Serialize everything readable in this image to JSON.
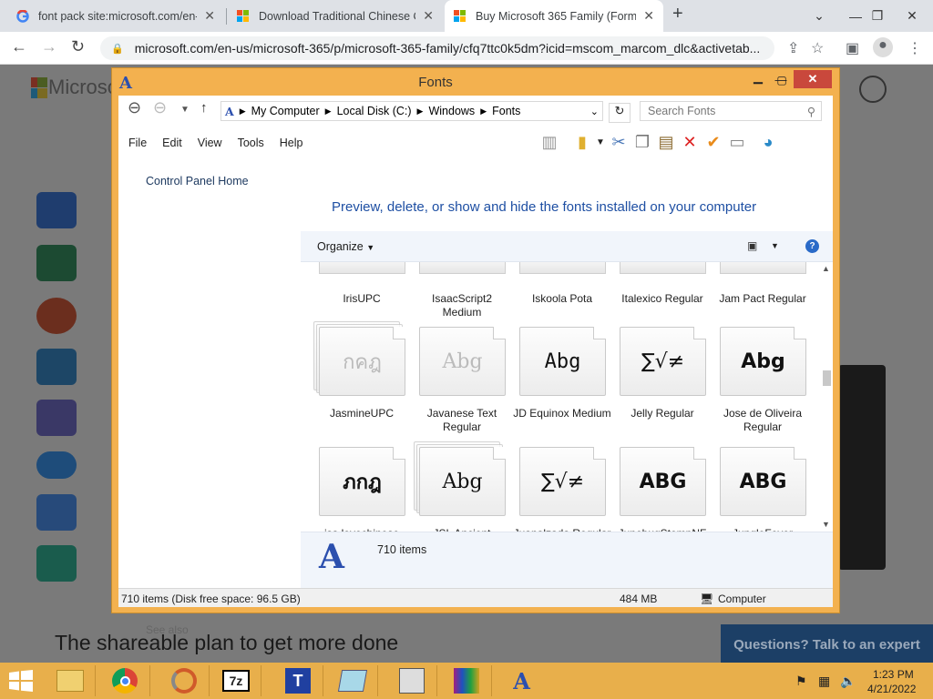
{
  "browser": {
    "tabs": [
      {
        "title": "font pack site:microsoft.com/en-",
        "active": false,
        "icon": "google-icon"
      },
      {
        "title": "Download Traditional Chinese Cl",
        "active": false,
        "icon": "microsoft-icon"
      },
      {
        "title": "Buy Microsoft 365 Family (Forme",
        "active": true,
        "icon": "microsoft-icon"
      }
    ],
    "url": "microsoft.com/en-us/microsoft-365/p/microsoft-365-family/cfq7ttc0k5dm?icid=mscom_marcom_dlc&activetab..."
  },
  "page": {
    "logo_text": "Microsoft",
    "heading": "The shareable plan to get more done",
    "chat_button": "Questions? Talk to an expert"
  },
  "dialog": {
    "title": "Fonts",
    "breadcrumbs": [
      "My Computer",
      "Local Disk (C:)",
      "Windows",
      "Fonts"
    ],
    "search_placeholder": "Search Fonts",
    "menu": [
      "File",
      "Edit",
      "View",
      "Tools",
      "Help"
    ],
    "left_link": "Control Panel Home",
    "see_also": "See also",
    "headline": "Preview, delete, or show and hide the fonts installed on your computer",
    "organize": "Organize",
    "fonts_row0": [
      "IrisUPC",
      "IsaacScript2 Medium",
      "Iskoola Pota",
      "Italexico Regular",
      "Jam Pact Regular"
    ],
    "fonts_row1": [
      {
        "name": "JasmineUPC",
        "preview": "กคฎ",
        "family": "DejaVu Sans",
        "weight": "normal",
        "stacked": true,
        "faded": true
      },
      {
        "name": "Javanese Text Regular",
        "preview": "Abg",
        "family": "DejaVu Serif",
        "weight": "normal",
        "stacked": false,
        "faded": true
      },
      {
        "name": "JD Equinox Medium",
        "preview": "Abg",
        "family": "DejaVu Sans Mono",
        "weight": "normal",
        "stacked": false,
        "faded": false
      },
      {
        "name": "Jelly Regular",
        "preview": "∑√≠",
        "family": "DejaVu Sans",
        "weight": "normal",
        "stacked": false,
        "faded": false
      },
      {
        "name": "Jose de Oliveira Regular",
        "preview": "Abg",
        "family": "DejaVu Sans",
        "weight": "bold",
        "stacked": false,
        "faded": false
      }
    ],
    "fonts_row2": [
      {
        "name": "jsa lovechinese Regular",
        "preview": "ภกฎ",
        "family": "DejaVu Serif",
        "weight": "bold",
        "stacked": false,
        "faded": false
      },
      {
        "name": "JSL Ancient",
        "preview": "Abg",
        "family": "DejaVu Serif",
        "weight": "normal",
        "stacked": true,
        "faded": false
      },
      {
        "name": "Juanalzada Regular",
        "preview": "∑√≠",
        "family": "DejaVu Sans",
        "weight": "normal",
        "stacked": false,
        "faded": false
      },
      {
        "name": "JunebugStompNF ExtraBold",
        "preview": "ABG",
        "family": "DejaVu Sans",
        "weight": "bold",
        "stacked": false,
        "faded": false
      },
      {
        "name": "JungleFever Regular",
        "preview": "ABG",
        "family": "DejaVu Sans",
        "weight": "bold",
        "stacked": false,
        "faded": false
      }
    ],
    "item_count": "710 items",
    "status_left": "710 items (Disk free space: 96.5 GB)",
    "status_size": "484 MB",
    "status_location": "Computer"
  },
  "taskbar": {
    "apps": [
      "file-explorer-icon",
      "chrome-icon",
      "app-icon",
      "7zip-icon",
      "typing-icon",
      "notepad-icon",
      "disk-icon",
      "winrar-icon",
      "fonts-icon"
    ],
    "time": "1:23 PM",
    "date": "4/21/2022"
  }
}
